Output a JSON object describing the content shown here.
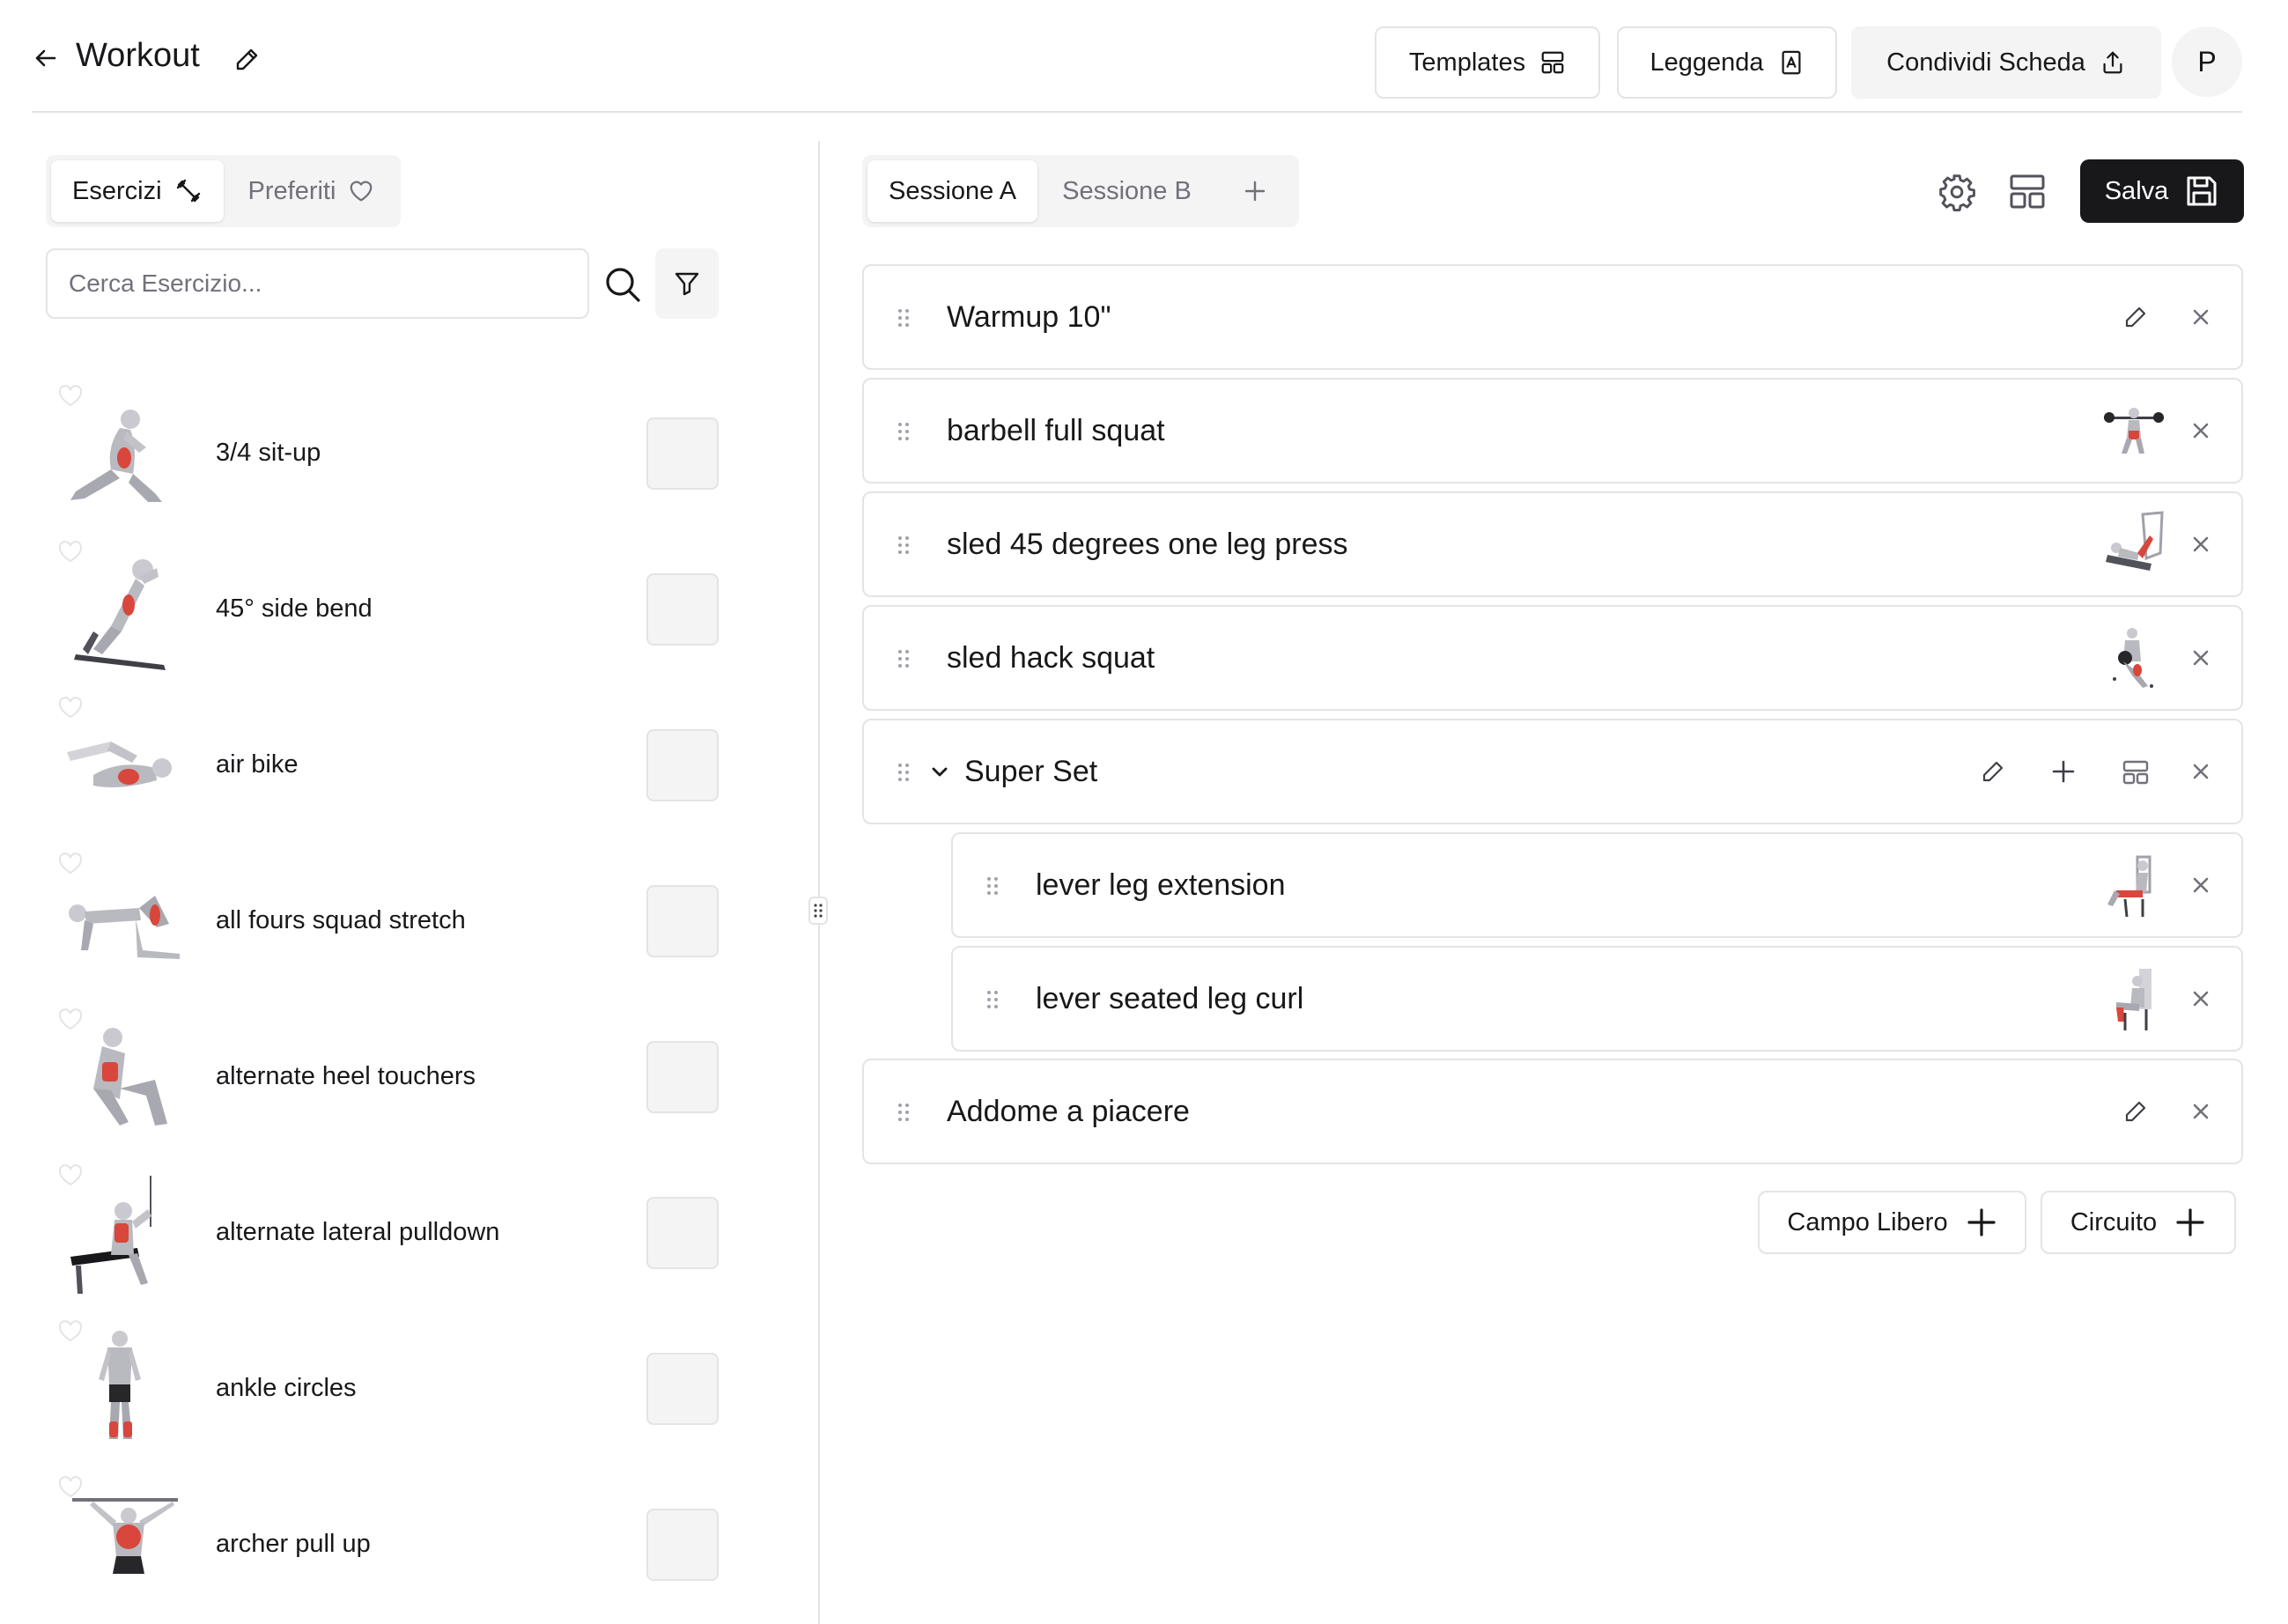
{
  "header": {
    "title": "Workout",
    "templates_label": "Templates",
    "legend_label": "Leggenda",
    "share_label": "Condividi Scheda",
    "avatar_initial": "P"
  },
  "library": {
    "tabs": [
      {
        "label": "Esercizi",
        "icon": "dumbbell-icon",
        "active": true
      },
      {
        "label": "Preferiti",
        "icon": "heart-icon",
        "active": false
      }
    ],
    "search": {
      "placeholder": "Cerca Esercizio...",
      "value": ""
    },
    "exercises": [
      {
        "name": "3/4 sit-up"
      },
      {
        "name": "45° side bend"
      },
      {
        "name": "air bike"
      },
      {
        "name": "all fours squad stretch"
      },
      {
        "name": "alternate heel touchers"
      },
      {
        "name": "alternate lateral pulldown"
      },
      {
        "name": "ankle circles"
      },
      {
        "name": "archer pull up"
      }
    ]
  },
  "sessions": {
    "tabs": [
      {
        "label": "Sessione A",
        "active": true
      },
      {
        "label": "Sessione B",
        "active": false
      }
    ],
    "save_label": "Salva",
    "items": [
      {
        "label": "Warmup 10\"",
        "kind": "free-field"
      },
      {
        "label": "barbell full squat",
        "kind": "exercise"
      },
      {
        "label": "sled 45 degrees one leg press",
        "kind": "exercise"
      },
      {
        "label": "sled hack squat",
        "kind": "exercise"
      },
      {
        "label": "Super Set",
        "kind": "superset"
      },
      {
        "label": "lever leg extension",
        "kind": "exercise-nested"
      },
      {
        "label": "lever seated leg curl",
        "kind": "exercise-nested"
      },
      {
        "label": "Addome a piacere",
        "kind": "free-field"
      }
    ],
    "add_free_field_label": "Campo Libero",
    "add_circuit_label": "Circuito"
  },
  "colors": {
    "text": "#18181b",
    "muted": "#71717a",
    "border": "#e4e4e7",
    "surface": "#f4f4f5",
    "primary": "#18181b",
    "muscle_highlight": "#d9463b"
  }
}
